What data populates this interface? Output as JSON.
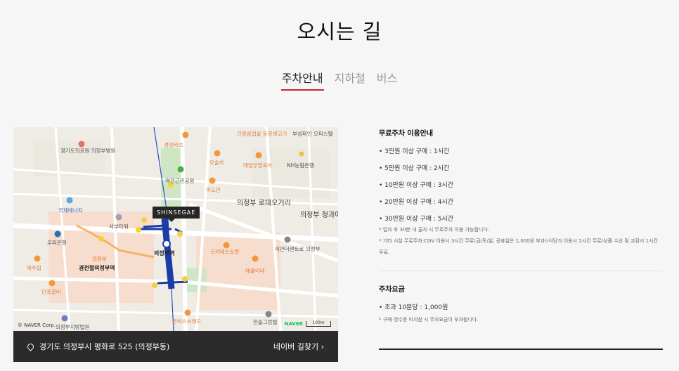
{
  "page": {
    "title": "오시는 길"
  },
  "tabs": [
    {
      "label": "주차안내",
      "active": true
    },
    {
      "label": "지하철",
      "active": false
    },
    {
      "label": "버스",
      "active": false
    }
  ],
  "map": {
    "store_label": "SHINSEGAE",
    "place_labels": [
      "경기도의료원 의정부병원",
      "경양카츠",
      "간장삼겹살 동봉생고기",
      "부성파인 오피스텔",
      "오술차",
      "태양부엉포차",
      "NH농협은행",
      "역전근린공원",
      "미도인",
      "의정부 로데오거리",
      "의정부 청과야채시장",
      "국제에너지",
      "서부타워",
      "우리은행",
      "의정부",
      "제주집",
      "경전철의정부역",
      "의정부역",
      "굿캬레스토랑",
      "이안더센트로 의정부",
      "애플이네",
      "만포갈비",
      "의정부지방법원",
      "은비스브레드",
      "한솔그랑빌"
    ],
    "credit": "© NAVER Corp.",
    "naver_logo": "NAVER",
    "scale": "100m",
    "address": "경기도 의정부시 평화로 525 (의정부동)",
    "naver_link": "네이버 길찾기 ›",
    "colors": {
      "subway": "#1b3da3",
      "road": "#ffffff",
      "park": "#cfe6c4",
      "block": "#f7d9c8"
    }
  },
  "free_parking": {
    "title": "무료주차 이용안내",
    "items": [
      "• 3만원 이상 구매 : 1시간",
      "• 5만원 이상 구매 : 2시간",
      "• 10만원 이상 구매 : 3시간",
      "• 20만원 이상 구매 : 4시간",
      "• 30만원 이상 구매 : 5시간"
    ],
    "notes": [
      "* 입차 후 30분 내 출차 시 무료주차 이용 가능합니다.",
      "* 기타 시설 무료주차:CGV 이용시 3시간 무료(금/토/일, 공휴일은 1,000원 부과)/식당가 이용시 2시간 무료/상품 수선 및 교환시 1시간 무료."
    ]
  },
  "parking_fee": {
    "title": "주차요금",
    "items": [
      "• 초과 10분당 : 1,000원"
    ],
    "notes": [
      "* 구매 영수증 미지참 시 주차요금이 부과됩니다."
    ]
  }
}
